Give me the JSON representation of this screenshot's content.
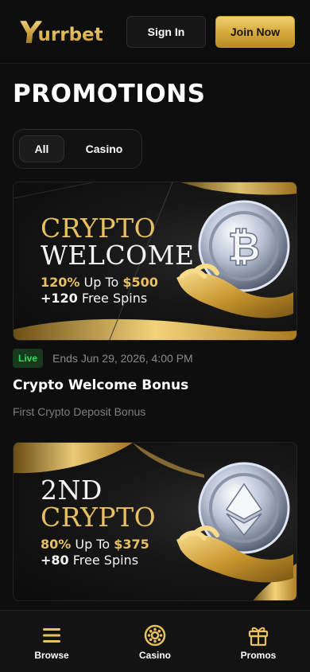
{
  "header": {
    "logo_initial": "Y",
    "logo_rest": "urrbet",
    "sign_in_label": "Sign In",
    "join_label": "Join Now"
  },
  "page_title": "PROMOTIONS",
  "filters": {
    "active": "All",
    "items": [
      "All",
      "Casino"
    ]
  },
  "promotions": [
    {
      "banner_line1": "CRYPTO",
      "banner_line2": "WELCOME",
      "offer_pct": "120%",
      "offer_upto": " Up To ",
      "offer_amount": "$500",
      "offer_spins": "+120",
      "offer_spins_text": " Free Spins",
      "coin": "bitcoin-icon",
      "status": "Live",
      "ends": "Ends Jun 29, 2026, 4:00 PM",
      "title": "Crypto Welcome Bonus",
      "subtitle": "First Crypto Deposit Bonus"
    },
    {
      "banner_line1": "2ND",
      "banner_line2": "CRYPTO",
      "offer_pct": "80%",
      "offer_upto": " Up To ",
      "offer_amount": "$375",
      "offer_spins": "+80",
      "offer_spins_text": " Free Spins",
      "coin": "ethereum-icon"
    }
  ],
  "bottom_nav": {
    "items": [
      {
        "label": "Browse",
        "icon": "menu-icon"
      },
      {
        "label": "Casino",
        "icon": "roulette-icon"
      },
      {
        "label": "Promos",
        "icon": "gift-icon",
        "active": true
      }
    ]
  },
  "colors": {
    "background": "#0e0e0e",
    "gold": "#e8c060",
    "live_green": "#35d95a"
  }
}
